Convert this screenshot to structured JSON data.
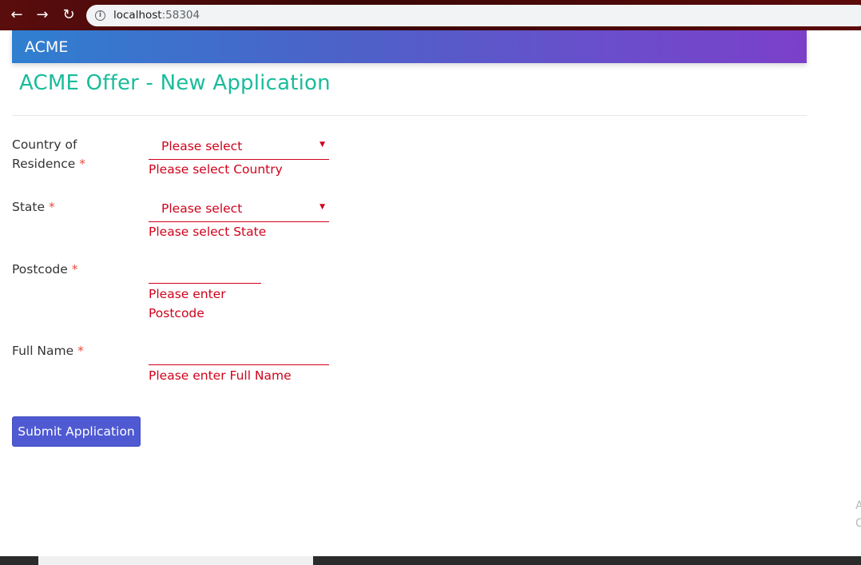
{
  "browser": {
    "back_icon": "arrow-left-icon",
    "forward_icon": "arrow-right-icon",
    "reload_icon": "reload-icon",
    "info_icon": "info-icon",
    "url_host": "localhost",
    "url_port": ":58304"
  },
  "header": {
    "brand": "ACME"
  },
  "page": {
    "title": "ACME Offer - New Application"
  },
  "form": {
    "required_marker": "*",
    "country": {
      "label_line1": "Country of",
      "label_line2": "Residence",
      "value": "Please select",
      "error": "Please select Country"
    },
    "state": {
      "label": "State",
      "value": "Please select",
      "error": "Please select State"
    },
    "postcode": {
      "label": "Postcode",
      "value": "",
      "error_line1": "Please enter",
      "error_line2": "Postcode"
    },
    "full_name": {
      "label": "Full Name",
      "value": "",
      "error": "Please enter Full Name"
    },
    "submit_label": "Submit Application"
  },
  "colors": {
    "accent_title": "#1abc9c",
    "error": "#d0021b",
    "button": "#4e59d2",
    "header_gradient_start": "#2f7fd0",
    "header_gradient_end": "#7b40c9"
  }
}
